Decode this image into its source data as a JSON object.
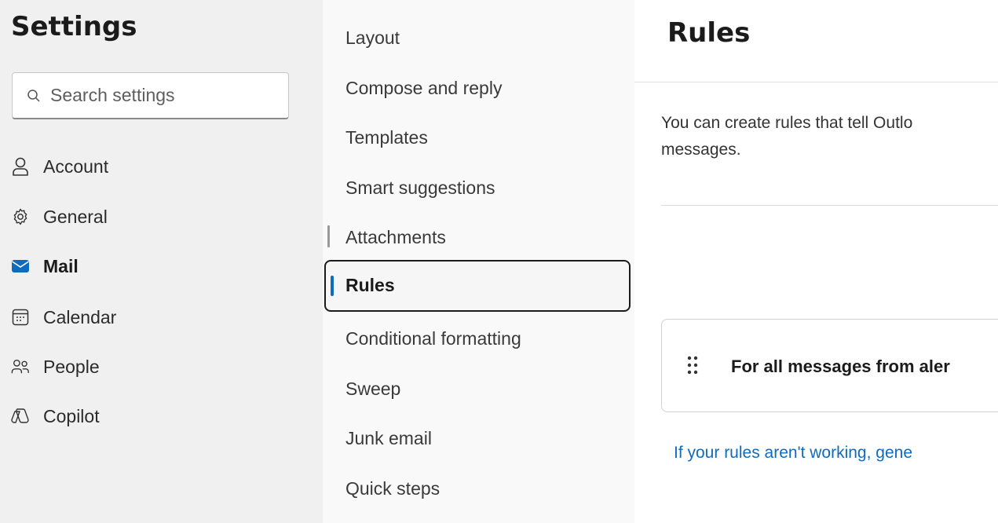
{
  "settings": {
    "title": "Settings",
    "search_placeholder": "Search settings",
    "nav": [
      {
        "label": "Account",
        "icon": "person-icon",
        "active": false
      },
      {
        "label": "General",
        "icon": "gear-icon",
        "active": false
      },
      {
        "label": "Mail",
        "icon": "mail-icon",
        "active": true
      },
      {
        "label": "Calendar",
        "icon": "calendar-icon",
        "active": false
      },
      {
        "label": "People",
        "icon": "people-icon",
        "active": false
      },
      {
        "label": "Copilot",
        "icon": "copilot-icon",
        "active": false
      }
    ]
  },
  "mail_settings": {
    "items": [
      "Layout",
      "Compose and reply",
      "Templates",
      "Smart suggestions",
      "Attachments",
      "Rules",
      "Conditional formatting",
      "Sweep",
      "Junk email",
      "Quick steps"
    ],
    "selected": "Rules"
  },
  "rules": {
    "title": "Rules",
    "description": "You can create rules that tell Outlo messages.",
    "description_line1": "You can create rules that tell Outlo",
    "description_line2": "messages.",
    "rule_name": "For all messages from aler",
    "help_link": "If your rules aren't working, gene"
  },
  "colors": {
    "accent": "#0f6cbd",
    "left_bg": "#f0f0f0",
    "middle_bg": "#f9f9f9"
  }
}
